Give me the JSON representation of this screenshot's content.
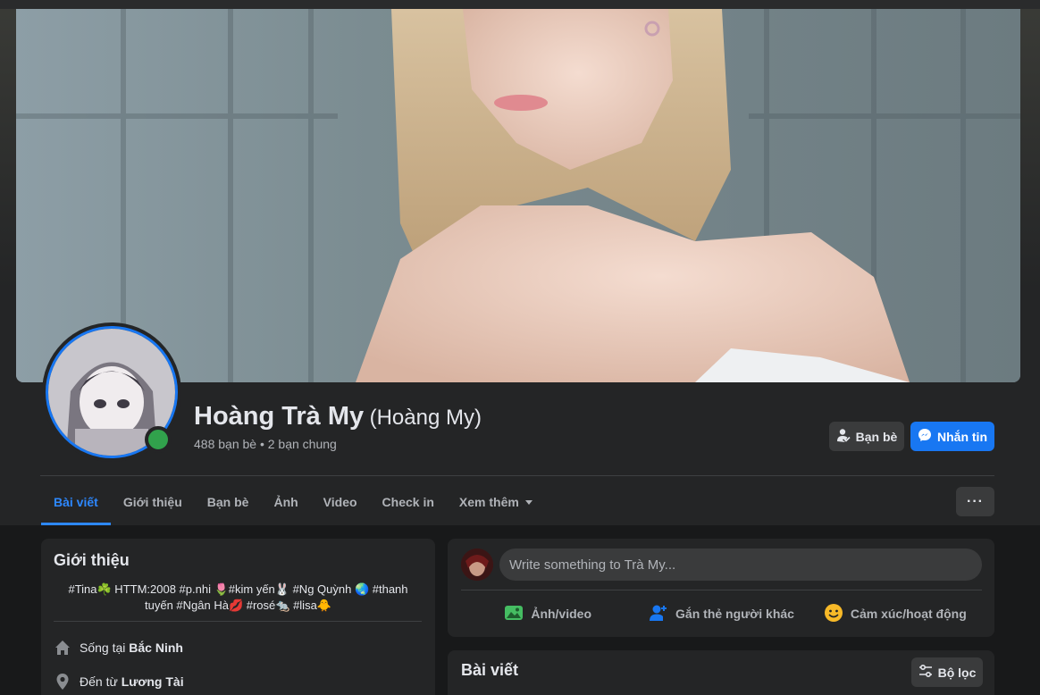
{
  "profile": {
    "name": "Hoàng Trà My",
    "alternate_name": "(Hoàng My)",
    "friends_info": "488 bạn bè • 2 bạn chung",
    "online": true
  },
  "actions": {
    "friends_label": "Bạn bè",
    "message_label": "Nhắn tin",
    "more_label": "···"
  },
  "tabs": [
    {
      "label": "Bài viết",
      "active": true
    },
    {
      "label": "Giới thiệu",
      "active": false
    },
    {
      "label": "Bạn bè",
      "active": false
    },
    {
      "label": "Ảnh",
      "active": false
    },
    {
      "label": "Video",
      "active": false
    },
    {
      "label": "Check in",
      "active": false
    },
    {
      "label": "Xem thêm",
      "active": false
    }
  ],
  "intro": {
    "title": "Giới thiệu",
    "bio_line1": "#Tina☘️ HTTM:2008 #p.nhi 🌷#kim yến🐰 #Ng Quỳnh 🌏 #thanh",
    "bio_line2": "tuyến #Ngân Hà💋 #rosé🐀 #lisa🐥",
    "lives_prefix": "Sống tại",
    "lives_place": "Bắc Ninh",
    "from_prefix": "Đến từ",
    "from_place": "Lương Tài"
  },
  "composer": {
    "placeholder": "Write something to Trà My...",
    "photo_label": "Ảnh/video",
    "tag_label": "Gắn thẻ người khác",
    "feeling_label": "Cảm xúc/hoạt động"
  },
  "posts": {
    "title": "Bài viết",
    "filter_label": "Bộ lọc"
  },
  "colors": {
    "accent": "#1877f2",
    "active_tab": "#2d88ff",
    "online": "#31a24c",
    "photo_icon": "#45bd62",
    "tag_icon": "#1877f2",
    "feeling_icon": "#f7b928"
  }
}
